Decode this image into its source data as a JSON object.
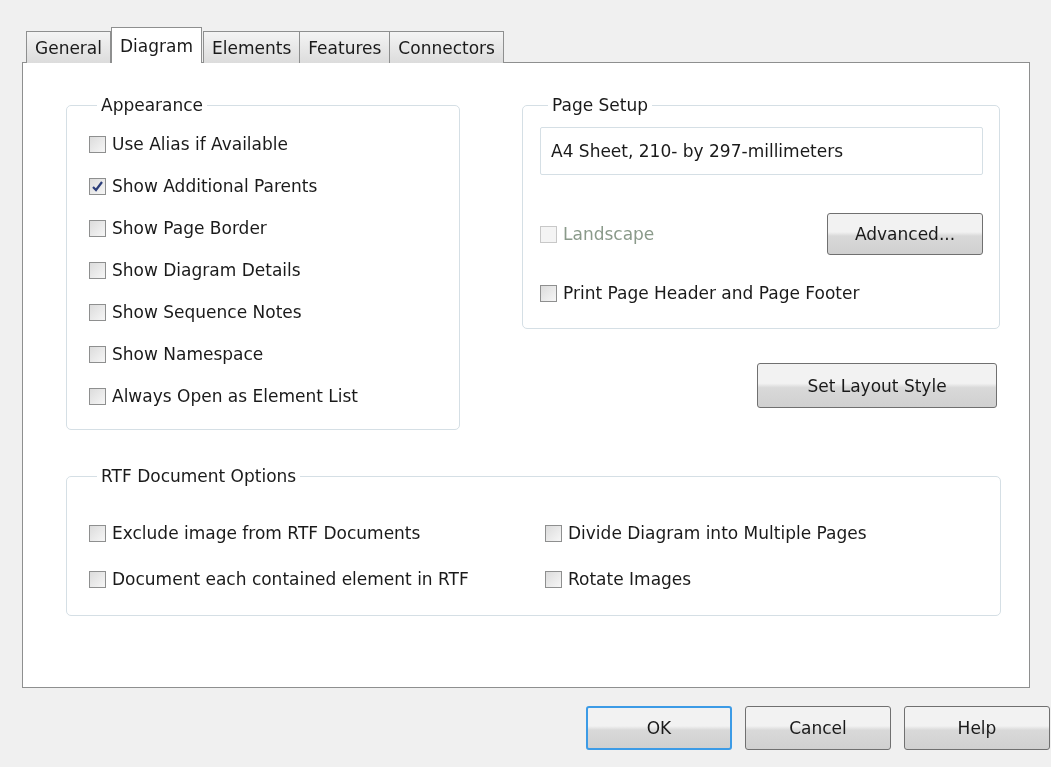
{
  "tabs": [
    {
      "label": "General",
      "selected": false
    },
    {
      "label": "Diagram",
      "selected": true
    },
    {
      "label": "Elements",
      "selected": false
    },
    {
      "label": "Features",
      "selected": false
    },
    {
      "label": "Connectors",
      "selected": false
    }
  ],
  "appearance": {
    "title": "Appearance",
    "options": [
      {
        "label": "Use Alias if Available",
        "checked": false
      },
      {
        "label": "Show Additional Parents",
        "checked": true
      },
      {
        "label": "Show Page Border",
        "checked": false
      },
      {
        "label": "Show Diagram Details",
        "checked": false
      },
      {
        "label": "Show Sequence Notes",
        "checked": false
      },
      {
        "label": "Show Namespace",
        "checked": false
      },
      {
        "label": "Always Open as Element List",
        "checked": false
      }
    ]
  },
  "page_setup": {
    "title": "Page Setup",
    "paper_size": "A4 Sheet, 210- by 297-millimeters",
    "landscape": {
      "label": "Landscape",
      "checked": false,
      "disabled": true
    },
    "advanced_button": "Advanced...",
    "print_header_footer": {
      "label": "Print Page Header and Page Footer",
      "checked": false,
      "disabled": false
    }
  },
  "set_layout_style_button": "Set Layout Style",
  "rtf_options": {
    "title": "RTF Document Options",
    "options": [
      {
        "label": "Exclude image from RTF Documents",
        "checked": false
      },
      {
        "label": "Divide Diagram into Multiple Pages",
        "checked": false
      },
      {
        "label": "Document each contained element in RTF",
        "checked": false
      },
      {
        "label": "Rotate Images",
        "checked": false
      }
    ]
  },
  "buttons": [
    {
      "label": "OK",
      "default": true
    },
    {
      "label": "Cancel",
      "default": false
    },
    {
      "label": "Help",
      "default": false
    }
  ]
}
